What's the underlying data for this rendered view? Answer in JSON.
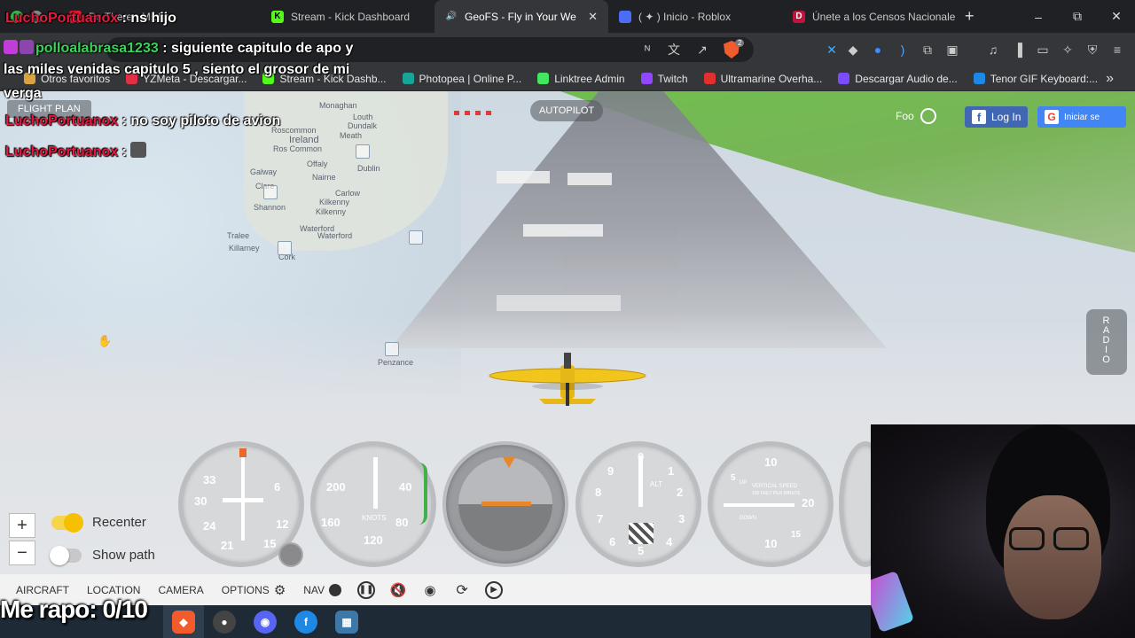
{
  "browser": {
    "tabs": [
      {
        "title": "Be There - Micha",
        "favicon_color": "#e0192d"
      },
      {
        "title": "Stream - Kick Dashboard",
        "favicon_color": "#53fc18"
      },
      {
        "title": "GeoFS - Fly in Your We",
        "favicon_color": "#6aa0ff",
        "active": true,
        "close": "✕"
      },
      {
        "title": "( ✦ ) Inicio - Roblox",
        "favicon_color": "#4a6cf7"
      },
      {
        "title": "Únete a los Censos Nacionale",
        "favicon_color": "#c0143c"
      }
    ],
    "new_tab": "+",
    "window": {
      "minimize": "–",
      "maximize": "⧉",
      "close": "✕"
    },
    "brave_badge": "2",
    "bookmarks": [
      {
        "label": "Otros favoritos",
        "color": "#d9a440"
      },
      {
        "label": "YZMeta - Descargar...",
        "color": "#e03045"
      },
      {
        "label": "Stream - Kick Dashb...",
        "color": "#53fc18"
      },
      {
        "label": "Photopea | Online P...",
        "color": "#18a497"
      },
      {
        "label": "Linktree Admin",
        "color": "#43e660"
      },
      {
        "label": "Twitch",
        "color": "#9146ff"
      },
      {
        "label": "Ultramarine Overha...",
        "color": "#e03030"
      },
      {
        "label": "Descargar Audio de...",
        "color": "#7a4bff"
      },
      {
        "label": "Tenor GIF Keyboard:...",
        "color": "#1e88e5"
      }
    ],
    "bookmarks_more": "»"
  },
  "chat": [
    {
      "user": "LuchoPortuanox",
      "message": ": ns hijo"
    },
    {
      "user": "polloalabrasa1233",
      "message": ": siguiente capitulo de apo y"
    },
    {
      "user": "",
      "message": "las miles venidas capitulo 5 , siento el grosor de mi"
    },
    {
      "user": "",
      "message": "verga"
    },
    {
      "user": "LuchoPortuanox",
      "message": ": no soy piloto de avion"
    },
    {
      "user": "LuchoPortuanox",
      "message": ":"
    }
  ],
  "game": {
    "flight_plan": "FLIGHT PLAN",
    "autopilot": "AUTOPILOT",
    "foo_label": "Foo",
    "login_facebook": "Log In",
    "login_google": "Iniciar se",
    "radio_letters": [
      "R",
      "A",
      "D",
      "I",
      "O"
    ],
    "zoom_in": "+",
    "zoom_out": "−",
    "recenter": "Recenter",
    "show_path": "Show path",
    "map_labels": {
      "ireland": "Ireland",
      "monaghan": "Monaghan",
      "louth": "Louth",
      "dundalk": "Dundalk",
      "roscommon": "Roscommon",
      "ros_common": "Ros Common",
      "meath": "Meath",
      "galway": "Galway",
      "clare": "Clare",
      "offaly": "Offaly",
      "dublin": "Dublin",
      "shannon": "Shannon",
      "nairne": "Nairne",
      "carlow": "Carlow",
      "kilkenny": "Kilkenny",
      "kilkenny2": "Kilkenny",
      "tralee": "Tralee",
      "killarney": "Killarney",
      "cork": "Cork",
      "waterford": "Waterford",
      "waterford2": "Waterford",
      "penzance": "Penzance"
    },
    "gauges": {
      "compass": [
        "33",
        "30",
        "6",
        "12",
        "15",
        "21",
        "24"
      ],
      "airspeed": [
        "40",
        "80",
        "120",
        "160",
        "200"
      ],
      "airspeed_unit": "KNOTS",
      "altimeter": [
        "0",
        "1",
        "2",
        "3",
        "4",
        "5",
        "6",
        "7",
        "8",
        "9"
      ],
      "altimeter_label": "ALT",
      "vsi": [
        "10",
        "5",
        "20",
        "15",
        "10"
      ],
      "vsi_caption": "VERTICAL SPEED",
      "vsi_sub": "100 FEET PER MINUTE",
      "vsi_up": "UP",
      "vsi_down": "DOWN"
    },
    "nav": {
      "aircraft": "AIRCRAFT",
      "location": "LOCATION",
      "camera": "CAMERA",
      "options": "OPTIONS",
      "nav": "NAV"
    }
  },
  "stream_overlay": {
    "rate": "Me rapo: 0/10"
  }
}
